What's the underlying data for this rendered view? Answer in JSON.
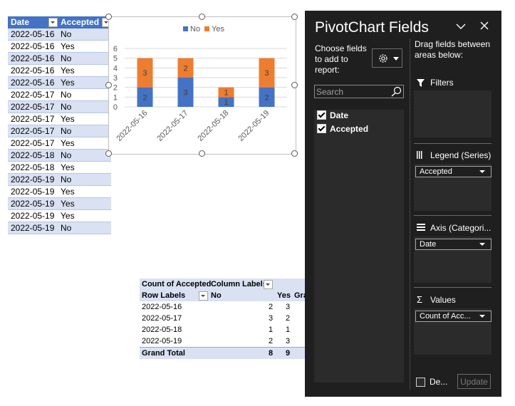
{
  "source_table": {
    "headers": [
      "Date",
      "Accepted"
    ],
    "rows": [
      [
        "2022-05-16",
        "No"
      ],
      [
        "2022-05-16",
        "Yes"
      ],
      [
        "2022-05-16",
        "No"
      ],
      [
        "2022-05-16",
        "Yes"
      ],
      [
        "2022-05-16",
        "Yes"
      ],
      [
        "2022-05-17",
        "No"
      ],
      [
        "2022-05-17",
        "No"
      ],
      [
        "2022-05-17",
        "Yes"
      ],
      [
        "2022-05-17",
        "No"
      ],
      [
        "2022-05-17",
        "Yes"
      ],
      [
        "2022-05-18",
        "No"
      ],
      [
        "2022-05-18",
        "Yes"
      ],
      [
        "2022-05-19",
        "No"
      ],
      [
        "2022-05-19",
        "Yes"
      ],
      [
        "2022-05-19",
        "Yes"
      ],
      [
        "2022-05-19",
        "Yes"
      ],
      [
        "2022-05-19",
        "No"
      ]
    ]
  },
  "chart_data": {
    "type": "bar",
    "stacked": true,
    "categories": [
      "2022-05-16",
      "2022-05-17",
      "2022-05-18",
      "2022-05-19"
    ],
    "series": [
      {
        "name": "No",
        "values": [
          2,
          3,
          1,
          2
        ],
        "color": "#4472c4"
      },
      {
        "name": "Yes",
        "values": [
          3,
          2,
          1,
          3
        ],
        "color": "#ed7d31"
      }
    ],
    "ylim": [
      0,
      6
    ],
    "yticks": [
      "0",
      "1",
      "2",
      "3",
      "4",
      "5",
      "6"
    ],
    "legend": "top",
    "grid": true
  },
  "pivot": {
    "header1": [
      "Count of Accepted",
      "Column Labels"
    ],
    "header2": [
      "Row Labels",
      "No",
      "Yes",
      "Gra"
    ],
    "rows": [
      [
        "2022-05-16",
        "2",
        "3"
      ],
      [
        "2022-05-17",
        "3",
        "2"
      ],
      [
        "2022-05-18",
        "1",
        "1"
      ],
      [
        "2022-05-19",
        "2",
        "3"
      ]
    ],
    "grand_total": [
      "Grand Total",
      "8",
      "9"
    ]
  },
  "pane": {
    "title": "PivotChart Fields",
    "choose_label": "Choose fields to add to report:",
    "drag_label": "Drag fields between areas below:",
    "search_placeholder": "Search",
    "fields": [
      "Date",
      "Accepted"
    ],
    "areas": {
      "filters": "Filters",
      "legend": "Legend (Series)",
      "axis": "Axis (Categori...",
      "values": "Values"
    },
    "legend_field": "Accepted",
    "axis_field": "Date",
    "values_field": "Count of Acc...",
    "defer_label": "De...",
    "update_label": "Update"
  }
}
